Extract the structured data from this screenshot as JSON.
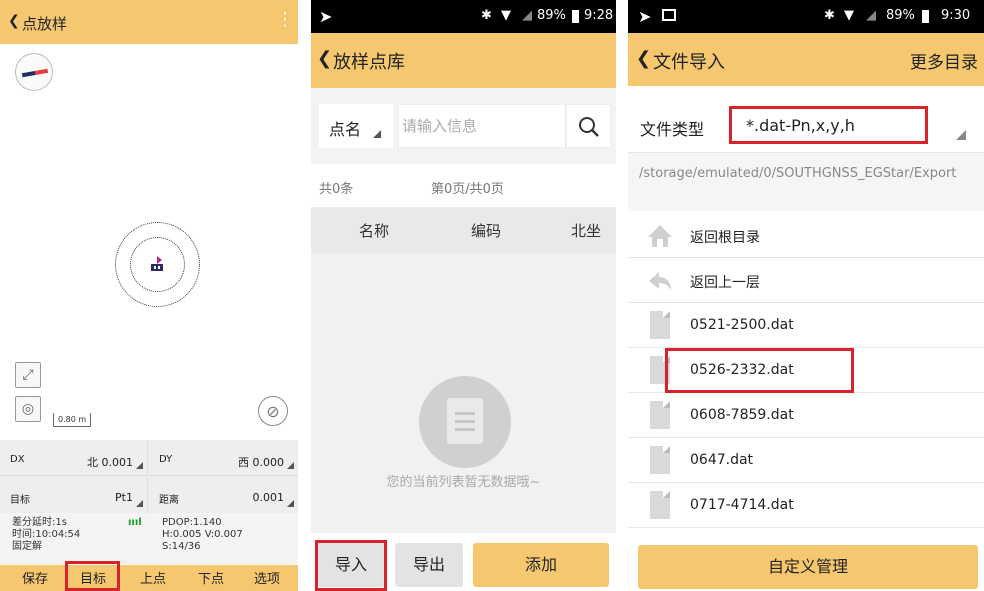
{
  "panel1": {
    "header": {
      "back_icon": "chevron-left-icon",
      "title": "点放样",
      "more_icon": "more-vertical-icon"
    },
    "scale_label": "0.80 m",
    "info": {
      "dx": {
        "label": "DX",
        "value": "北 0.001"
      },
      "dy": {
        "label": "DY",
        "value": "西 0.000"
      },
      "target": {
        "label": "目标",
        "value": "Pt1"
      },
      "distance": {
        "label": "距离",
        "value": "0.001"
      }
    },
    "status": {
      "delay": "差分延时:1s",
      "time": "时间:10:04:54",
      "solution": "固定解",
      "pdop": "PDOP:1.140",
      "hv": "H:0.005 V:0.007",
      "sats": "S:14/36",
      "signal_bars": "ıııl"
    },
    "buttons": [
      "保存",
      "目标",
      "上点",
      "下点",
      "选项"
    ]
  },
  "panel2": {
    "statusbar": {
      "time": "9:28",
      "battery": "89%"
    },
    "header": {
      "title": "放样点库"
    },
    "search": {
      "field": "点名",
      "placeholder": "请输入信息"
    },
    "count": {
      "total": "共0条",
      "page": "第0页/共0页"
    },
    "columns": [
      "名称",
      "编码",
      "北坐"
    ],
    "empty_message": "您的当前列表暂无数据哦~",
    "buttons": {
      "import": "导入",
      "export": "导出",
      "add": "添加"
    }
  },
  "panel3": {
    "statusbar": {
      "time": "9:30",
      "battery": "89%"
    },
    "header": {
      "title": "文件导入",
      "more": "更多目录"
    },
    "file_type": {
      "label": "文件类型",
      "value": "*.dat-Pn,x,y,h"
    },
    "path": "/storage/emulated/0/SOUTHGNSS_EGStar/Export",
    "nav": [
      {
        "label": "返回根目录",
        "icon": "home-icon"
      },
      {
        "label": "返回上一层",
        "icon": "back-arrow-icon"
      }
    ],
    "files": [
      "0521-2500.dat",
      "0526-2332.dat",
      "0608-7859.dat",
      "0647.dat",
      "0717-4714.dat"
    ],
    "custom_button": "自定义管理"
  },
  "colors": {
    "accent": "#f5c870",
    "highlight": "#d8232a"
  }
}
